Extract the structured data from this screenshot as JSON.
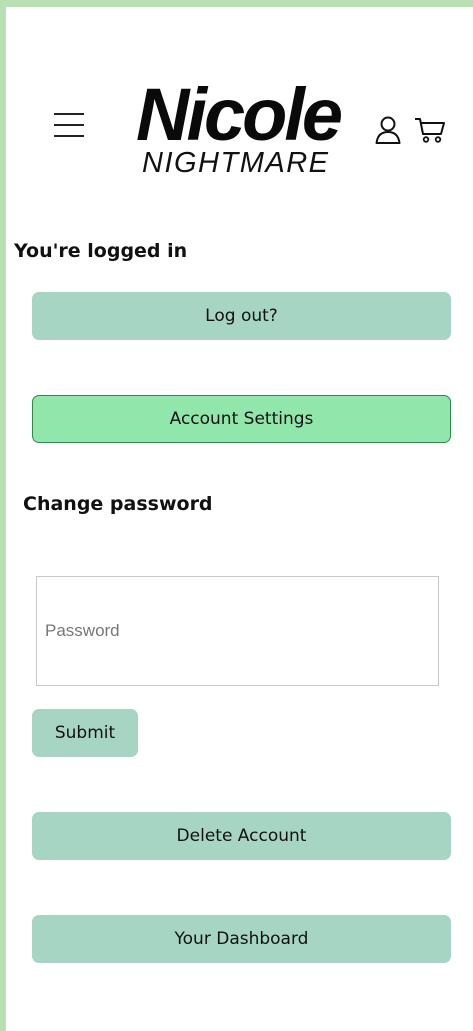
{
  "header": {
    "logo_main": "Nicole",
    "logo_sub": "NIGHTMARE",
    "icons": [
      "hamburger-menu-icon",
      "user-icon",
      "cart-icon"
    ]
  },
  "status": {
    "logged_in_text": "You're logged in"
  },
  "buttons": {
    "logout": "Log out?",
    "account_settings": "Account Settings",
    "delete_account": "Delete Account",
    "dashboard": "Your Dashboard"
  },
  "change_password": {
    "title": "Change password",
    "placeholder": "Password",
    "value": "",
    "submit": "Submit"
  },
  "colors": {
    "frame_border": "#b9dfb4",
    "button_bg": "#a6d6c3",
    "account_button_bg": "#90e6ab",
    "account_button_border": "#2f8a4a"
  }
}
